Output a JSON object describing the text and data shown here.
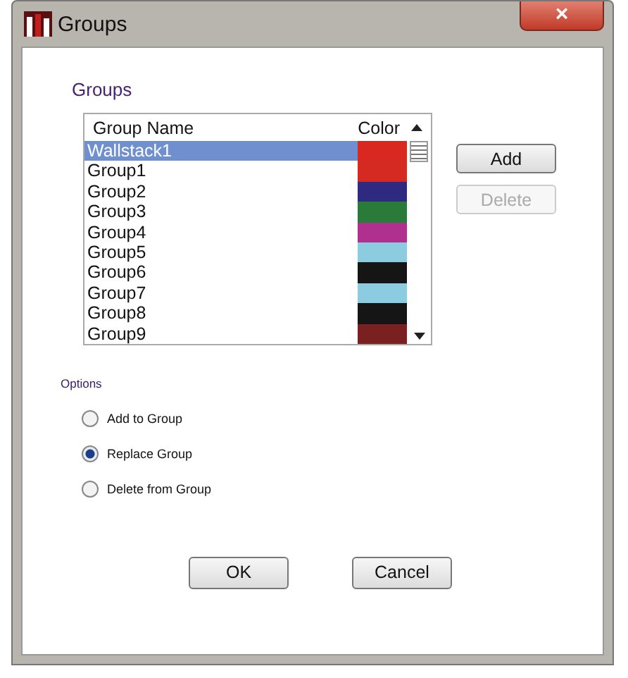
{
  "window": {
    "title": "Groups",
    "close": "×"
  },
  "groups_section": {
    "label": "Groups",
    "table": {
      "columns": [
        "Group Name",
        "Color"
      ],
      "rows": [
        {
          "name": "Wallstack1",
          "color": "#d9281f",
          "selected": true
        },
        {
          "name": "Group1",
          "color": "#d42a22",
          "selected": false
        },
        {
          "name": "Group2",
          "color": "#2e2a80",
          "selected": false
        },
        {
          "name": "Group3",
          "color": "#2a7a3a",
          "selected": false
        },
        {
          "name": "Group4",
          "color": "#b0308f",
          "selected": false
        },
        {
          "name": "Group5",
          "color": "#8ccbe0",
          "selected": false
        },
        {
          "name": "Group6",
          "color": "#151515",
          "selected": false
        },
        {
          "name": "Group7",
          "color": "#8ccbe0",
          "selected": false
        },
        {
          "name": "Group8",
          "color": "#151515",
          "selected": false
        },
        {
          "name": "Group9",
          "color": "#7a2020",
          "selected": false
        }
      ]
    },
    "buttons": [
      {
        "label": "Add",
        "disabled": false
      },
      {
        "label": "Delete",
        "disabled": true
      }
    ]
  },
  "options": {
    "label": "Options",
    "radios": [
      {
        "label": "Add to Group",
        "selected": false
      },
      {
        "label": "Replace Group",
        "selected": true
      },
      {
        "label": "Delete from Group",
        "selected": false
      }
    ]
  },
  "buttons": [
    "OK",
    "Cancel"
  ]
}
